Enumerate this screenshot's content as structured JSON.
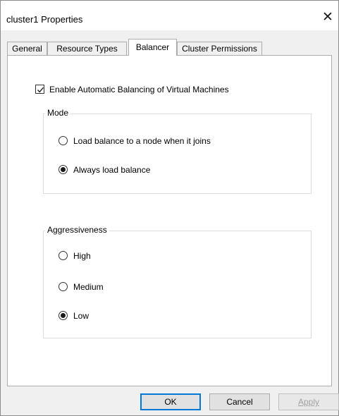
{
  "window": {
    "title": "cluster1 Properties",
    "close_glyph": "✕"
  },
  "tabs": [
    {
      "label": "General",
      "active": false
    },
    {
      "label": "Resource Types",
      "active": false
    },
    {
      "label": "Balancer",
      "active": true
    },
    {
      "label": "Cluster Permissions",
      "active": false
    }
  ],
  "balancer": {
    "enable_label": "Enable Automatic Balancing of Virtual Machines",
    "enable_checked": true,
    "mode": {
      "legend": "Mode",
      "options": [
        {
          "label": "Load balance to a node when it joins",
          "selected": false
        },
        {
          "label": "Always load balance",
          "selected": true
        }
      ]
    },
    "aggressiveness": {
      "legend": "Aggressiveness",
      "options": [
        {
          "label": "High",
          "selected": false
        },
        {
          "label": "Medium",
          "selected": false
        },
        {
          "label": "Low",
          "selected": true
        }
      ]
    }
  },
  "buttons": {
    "ok": "OK",
    "cancel": "Cancel",
    "apply": "Apply"
  },
  "colors": {
    "accent": "#0078d7",
    "dialog_bg": "#f0f0f0",
    "panel_bg": "#ffffff"
  }
}
